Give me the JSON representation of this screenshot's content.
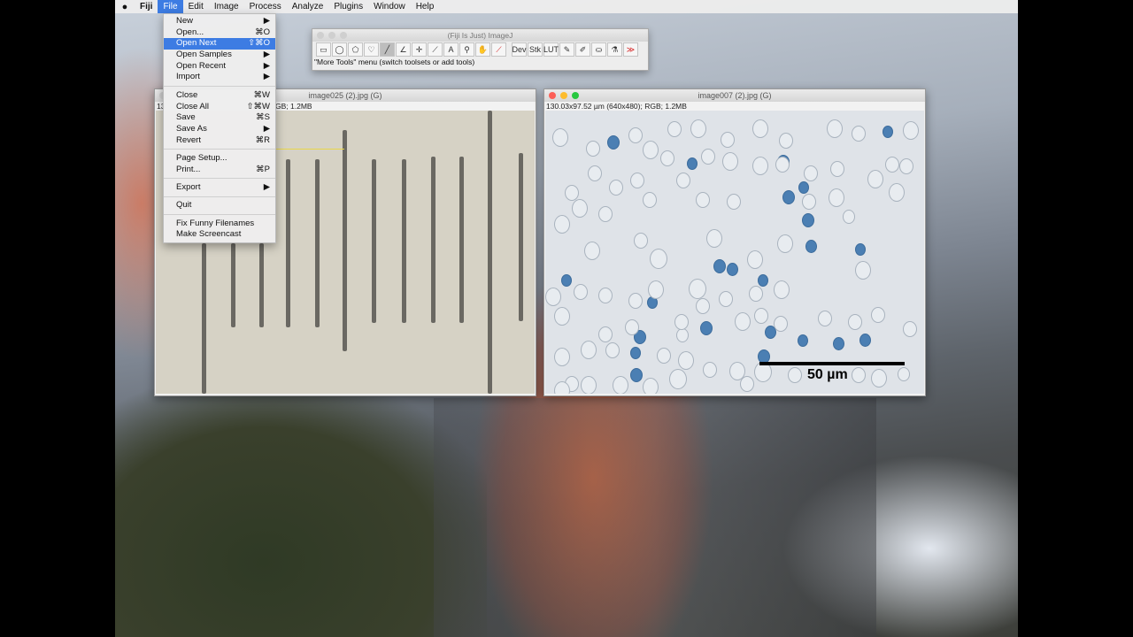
{
  "menubar": {
    "apple": "",
    "items": [
      "Fiji",
      "File",
      "Edit",
      "Image",
      "Process",
      "Analyze",
      "Plugins",
      "Window",
      "Help"
    ]
  },
  "file_menu": {
    "items": [
      {
        "label": "New",
        "shortcut": "▶"
      },
      {
        "label": "Open...",
        "shortcut": "⌘O"
      },
      {
        "label": "Open Next",
        "shortcut": "⇧⌘O"
      },
      {
        "label": "Open Samples",
        "shortcut": "▶"
      },
      {
        "label": "Open Recent",
        "shortcut": "▶"
      },
      {
        "label": "Import",
        "shortcut": "▶"
      },
      {
        "label": "Close",
        "shortcut": "⌘W"
      },
      {
        "label": "Close All",
        "shortcut": "⇧⌘W"
      },
      {
        "label": "Save",
        "shortcut": "⌘S"
      },
      {
        "label": "Save As",
        "shortcut": "▶"
      },
      {
        "label": "Revert",
        "shortcut": "⌘R"
      },
      {
        "label": "Page Setup...",
        "shortcut": ""
      },
      {
        "label": "Print...",
        "shortcut": "⌘P"
      },
      {
        "label": "Export",
        "shortcut": "▶"
      },
      {
        "label": "Quit",
        "shortcut": ""
      },
      {
        "label": "Fix Funny Filenames",
        "shortcut": ""
      },
      {
        "label": "Make Screencast",
        "shortcut": ""
      }
    ]
  },
  "toolbar_window": {
    "title": "(Fiji Is Just) ImageJ",
    "status": "\"More Tools\" menu (switch toolsets or add tools)",
    "tools": [
      {
        "icon": "rectangle-icon",
        "glyph": "▭"
      },
      {
        "icon": "oval-icon",
        "glyph": "◯"
      },
      {
        "icon": "polygon-icon",
        "glyph": "⬠"
      },
      {
        "icon": "freehand-icon",
        "glyph": "♡"
      },
      {
        "icon": "line-icon",
        "glyph": "╱"
      },
      {
        "icon": "angle-icon",
        "glyph": "∠"
      },
      {
        "icon": "point-icon",
        "glyph": "✛"
      },
      {
        "icon": "wand-icon",
        "glyph": "⟋"
      },
      {
        "icon": "text-icon",
        "glyph": "A"
      },
      {
        "icon": "magnifier-icon",
        "glyph": "⚲"
      },
      {
        "icon": "hand-icon",
        "glyph": "✋"
      },
      {
        "icon": "color-picker-icon",
        "glyph": "⟋"
      },
      {
        "icon": "dev-icon",
        "glyph": "Dev"
      },
      {
        "icon": "stack-icon",
        "glyph": "Stk"
      },
      {
        "icon": "lut-icon",
        "glyph": "LUT"
      },
      {
        "icon": "pencil-icon",
        "glyph": "✎"
      },
      {
        "icon": "brush-icon",
        "glyph": "✐"
      },
      {
        "icon": "flood-fill-icon",
        "glyph": "⛀"
      },
      {
        "icon": "pipette-icon",
        "glyph": "⚗"
      },
      {
        "icon": "more-tools-icon",
        "glyph": "≫"
      }
    ]
  },
  "window1": {
    "title": "image025 (2).jpg (G)",
    "info_left": "13",
    "info_right": "GB; 1.2MB"
  },
  "window2": {
    "title": "image007 (2).jpg (G)",
    "info": "130.03x97.52 µm (640x480); RGB; 1.2MB",
    "scale_label": "50 µm"
  },
  "colors": {
    "highlight": "#3d7ce3",
    "blue_cell": "#4b7fb3"
  }
}
